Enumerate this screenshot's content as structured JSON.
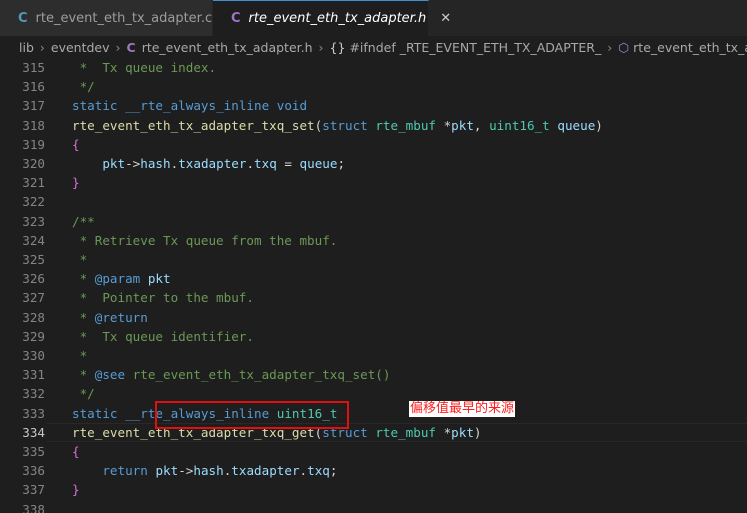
{
  "tabs": [
    {
      "icon": "C",
      "label": "rte_event_eth_tx_adapter.c",
      "active": false
    },
    {
      "icon": "C",
      "label": "rte_event_eth_tx_adapter.h",
      "active": true,
      "close": "✕"
    }
  ],
  "breadcrumb": [
    "lib",
    "eventdev",
    "rte_event_eth_tx_adapter.h",
    "#ifndef _RTE_EVENT_ETH_TX_ADAPTER_",
    "rte_event_eth_tx_adapter_t"
  ],
  "breadcrumb_icons": {
    "file": "C",
    "symbol": "{}"
  },
  "annotation": "偏移值最早的来源",
  "lines": [
    {
      "n": "315",
      "t": [
        [
          "cmt",
          " *  Tx queue index."
        ]
      ]
    },
    {
      "n": "316",
      "t": [
        [
          "cmt",
          " */"
        ]
      ]
    },
    {
      "n": "317",
      "t": [
        [
          "kw",
          "static"
        ],
        [
          "p",
          " "
        ],
        [
          "kw",
          "__rte_always_inline"
        ],
        [
          "p",
          " "
        ],
        [
          "kw",
          "void"
        ]
      ]
    },
    {
      "n": "318",
      "t": [
        [
          "fn",
          "rte_event_eth_tx_adapter_txq_set"
        ],
        [
          "p",
          "("
        ],
        [
          "kw",
          "struct"
        ],
        [
          "p",
          " "
        ],
        [
          "ty",
          "rte_mbuf"
        ],
        [
          "p",
          " *"
        ],
        [
          "var",
          "pkt"
        ],
        [
          "p",
          ", "
        ],
        [
          "ty",
          "uint16_t"
        ],
        [
          "p",
          " "
        ],
        [
          "var",
          "queue"
        ],
        [
          "p",
          ")"
        ]
      ]
    },
    {
      "n": "319",
      "t": [
        [
          "br",
          "{"
        ]
      ]
    },
    {
      "n": "320",
      "t": [
        [
          "p",
          "    "
        ],
        [
          "var",
          "pkt"
        ],
        [
          "p",
          "->"
        ],
        [
          "var",
          "hash"
        ],
        [
          "p",
          "."
        ],
        [
          "var",
          "txadapter"
        ],
        [
          "p",
          "."
        ],
        [
          "var",
          "txq"
        ],
        [
          "p",
          " = "
        ],
        [
          "var",
          "queue"
        ],
        [
          "p",
          ";"
        ]
      ]
    },
    {
      "n": "321",
      "t": [
        [
          "br",
          "}"
        ]
      ]
    },
    {
      "n": "322",
      "t": []
    },
    {
      "n": "323",
      "t": [
        [
          "cmt",
          "/**"
        ]
      ]
    },
    {
      "n": "324",
      "t": [
        [
          "cmt",
          " * Retrieve Tx queue from the mbuf."
        ]
      ]
    },
    {
      "n": "325",
      "t": [
        [
          "cmt",
          " *"
        ]
      ]
    },
    {
      "n": "326",
      "t": [
        [
          "cmt",
          " * "
        ],
        [
          "doc",
          "@param"
        ],
        [
          "p",
          " "
        ],
        [
          "var",
          "pkt"
        ]
      ]
    },
    {
      "n": "327",
      "t": [
        [
          "cmt",
          " *  Pointer to the mbuf."
        ]
      ]
    },
    {
      "n": "328",
      "t": [
        [
          "cmt",
          " * "
        ],
        [
          "doc",
          "@return"
        ]
      ]
    },
    {
      "n": "329",
      "t": [
        [
          "cmt",
          " *  Tx queue identifier."
        ]
      ]
    },
    {
      "n": "330",
      "t": [
        [
          "cmt",
          " *"
        ]
      ]
    },
    {
      "n": "331",
      "t": [
        [
          "cmt",
          " * "
        ],
        [
          "doc",
          "@see"
        ],
        [
          "cmt",
          " rte_event_eth_tx_adapter_txq_set()"
        ]
      ]
    },
    {
      "n": "332",
      "t": [
        [
          "cmt",
          " */"
        ]
      ]
    },
    {
      "n": "333",
      "t": [
        [
          "kw",
          "static"
        ],
        [
          "p",
          " "
        ],
        [
          "kw",
          "__rte_always_inline"
        ],
        [
          "p",
          " "
        ],
        [
          "ty",
          "uint16_t"
        ]
      ]
    },
    {
      "n": "334",
      "t": [
        [
          "fn",
          "rte_event_eth_tx_adapter_txq_get"
        ],
        [
          "p",
          "("
        ],
        [
          "kw",
          "struct"
        ],
        [
          "p",
          " "
        ],
        [
          "ty",
          "rte_mbuf"
        ],
        [
          "p",
          " *"
        ],
        [
          "var",
          "pkt"
        ],
        [
          "p",
          ")"
        ]
      ],
      "current": true
    },
    {
      "n": "335",
      "t": [
        [
          "br",
          "{"
        ]
      ]
    },
    {
      "n": "336",
      "t": [
        [
          "p",
          "    "
        ],
        [
          "kw",
          "return"
        ],
        [
          "p",
          " "
        ],
        [
          "var",
          "pkt"
        ],
        [
          "p",
          "->"
        ],
        [
          "var",
          "hash"
        ],
        [
          "p",
          "."
        ],
        [
          "var",
          "txadapter"
        ],
        [
          "p",
          "."
        ],
        [
          "var",
          "txq"
        ],
        [
          "p",
          ";"
        ]
      ]
    },
    {
      "n": "337",
      "t": [
        [
          "br",
          "}"
        ]
      ]
    },
    {
      "n": "338",
      "t": []
    }
  ]
}
